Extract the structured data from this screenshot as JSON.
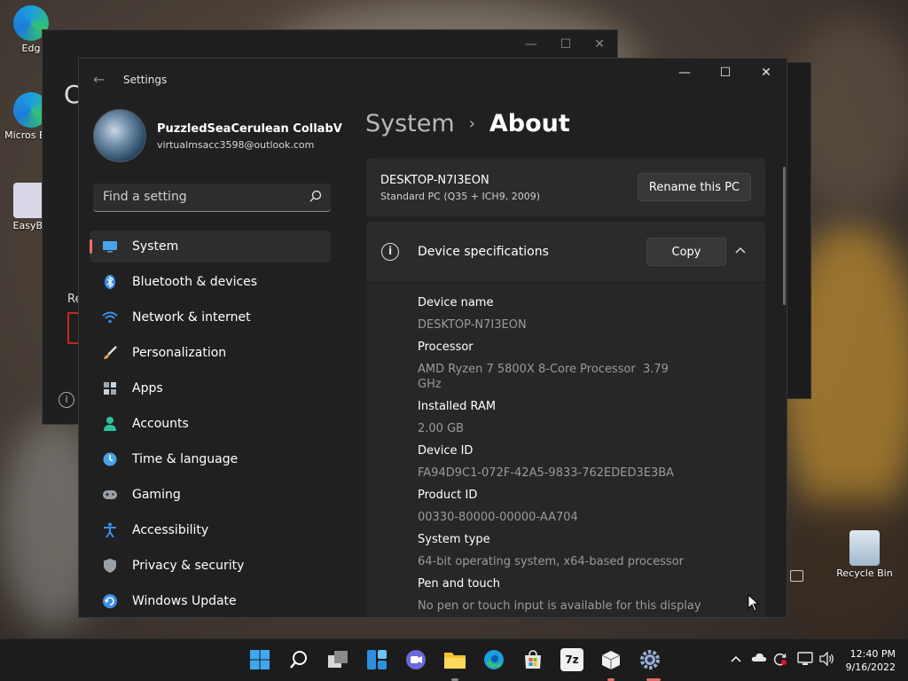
{
  "desktop": {
    "icons": [
      {
        "label": "Edg"
      },
      {
        "label": "Micros Edg"
      },
      {
        "label": "EasyBC"
      },
      {
        "label": "Recycle Bin"
      }
    ]
  },
  "background_window": {
    "big_letter": "C",
    "label_re": "Re"
  },
  "window": {
    "title": "Settings",
    "minimize": "—",
    "maximize": "☐",
    "close": "✕"
  },
  "profile": {
    "name": "PuzzledSeaCerulean CollabVM...",
    "email": "virtualmsacc3598@outlook.com"
  },
  "search": {
    "placeholder": "Find a setting"
  },
  "nav": {
    "items": [
      {
        "label": "System",
        "icon": "system-icon",
        "color": "#4aa3e8"
      },
      {
        "label": "Bluetooth & devices",
        "icon": "bluetooth-icon",
        "color": "#3b8eea"
      },
      {
        "label": "Network & internet",
        "icon": "wifi-icon",
        "color": "#3b8eea"
      },
      {
        "label": "Personalization",
        "icon": "brush-icon",
        "color": "#e8a04a"
      },
      {
        "label": "Apps",
        "icon": "apps-icon",
        "color": "#9aa6b4"
      },
      {
        "label": "Accounts",
        "icon": "accounts-icon",
        "color": "#2fbf9f"
      },
      {
        "label": "Time & language",
        "icon": "clock-globe-icon",
        "color": "#4aa3e8"
      },
      {
        "label": "Gaming",
        "icon": "gamepad-icon",
        "color": "#9aa0a8"
      },
      {
        "label": "Accessibility",
        "icon": "accessibility-icon",
        "color": "#3b8eea"
      },
      {
        "label": "Privacy & security",
        "icon": "shield-icon",
        "color": "#9aa0a8"
      },
      {
        "label": "Windows Update",
        "icon": "update-icon",
        "color": "#3b8eea"
      }
    ],
    "active_index": 0,
    "accent": "#ff6a6a"
  },
  "breadcrumb": {
    "parent": "System",
    "separator": "›",
    "current": "About"
  },
  "pc": {
    "name": "DESKTOP-N7I3EON",
    "model": "Standard PC (Q35 + ICH9, 2009)",
    "rename_label": "Rename this PC"
  },
  "specs": {
    "title": "Device specifications",
    "copy_label": "Copy",
    "device_name_label": "Device name",
    "device_name": "DESKTOP-N7I3EON",
    "processor_label": "Processor",
    "processor_value": "AMD Ryzen 7 5800X 8-Core Processor GHz",
    "processor_speed": "3.79",
    "ram_label": "Installed RAM",
    "ram_value": "2.00 GB",
    "device_id_label": "Device ID",
    "device_id": "FA94D9C1-072F-42A5-9833-762EDED3E3BA",
    "product_id_label": "Product ID",
    "product_id": "00330-80000-00000-AA704",
    "system_type_label": "System type",
    "system_type": "64-bit operating system, x64-based processor",
    "pen_label": "Pen and touch",
    "pen_value": "No pen or touch input is available for this display"
  },
  "taskbar": {
    "items": [
      "start-icon",
      "search-icon",
      "task-view-icon",
      "widgets-icon",
      "chat-icon",
      "file-explorer-icon",
      "edge-icon",
      "store-icon",
      "7zip-icon",
      "package-icon",
      "settings-icon"
    ],
    "sevenzip_label": "7z",
    "time": "12:40 PM",
    "date": "9/16/2022"
  }
}
